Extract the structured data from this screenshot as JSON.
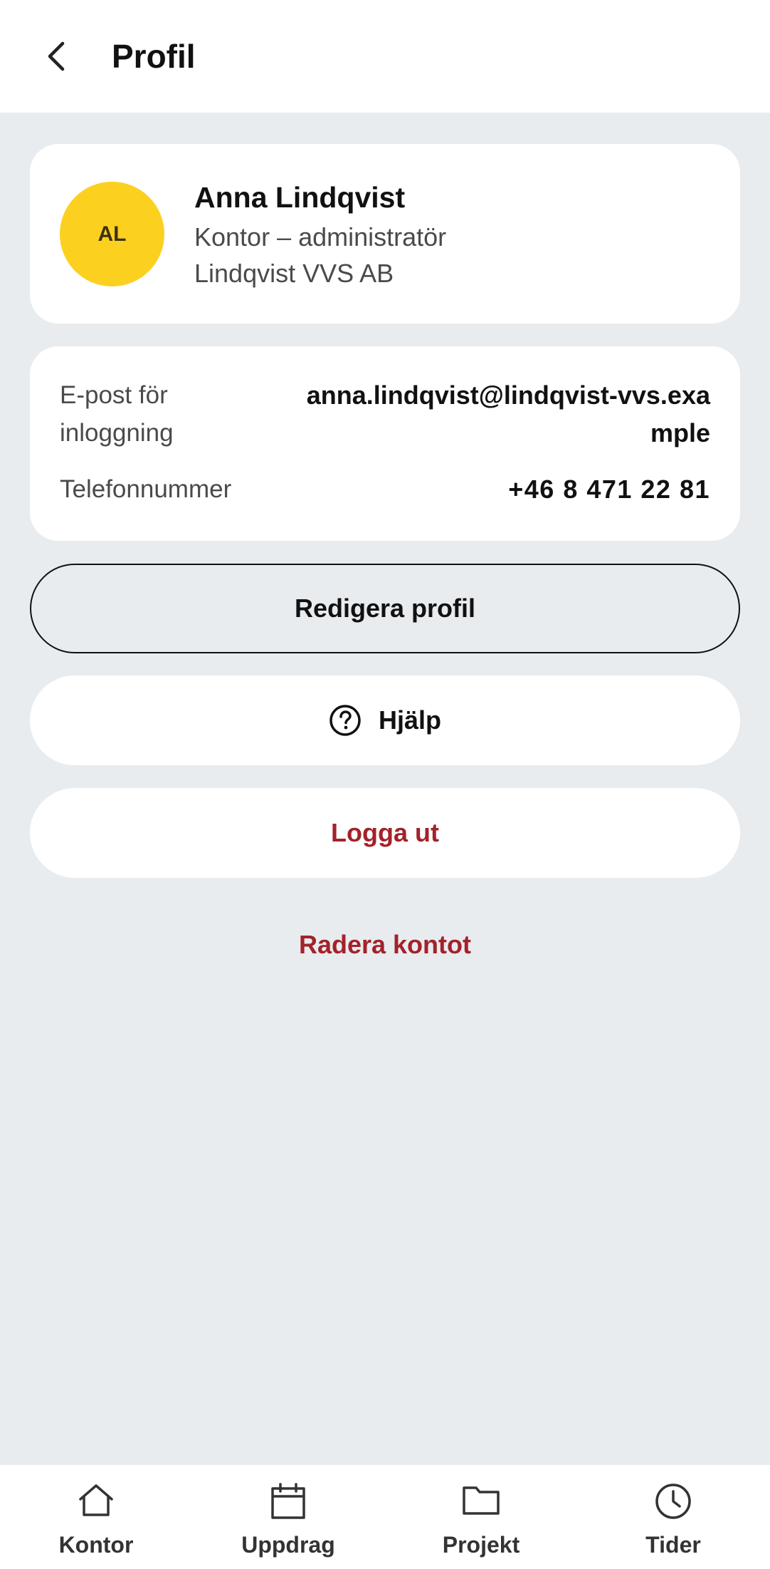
{
  "header": {
    "title": "Profil",
    "back_icon": "chevron-left-icon"
  },
  "profile": {
    "initials": "AL",
    "avatar_color": "#FCD01F",
    "name": "Anna Lindqvist",
    "role": "Kontor – administratör",
    "company": "Lindqvist VVS AB"
  },
  "info": {
    "email_label": "E-post för inloggning",
    "email_value": "anna.lindqvist@lindqvist-vvs.example",
    "phone_label": "Telefonnummer",
    "phone_value": "+46 8 471 22 81"
  },
  "actions": {
    "edit_label": "Redigera profil",
    "help_label": "Hjälp",
    "help_icon": "question-circle-icon",
    "logout_label": "Logga ut",
    "delete_label": "Radera kontot",
    "danger_color": "#A3222A"
  },
  "bottom_nav": {
    "items": [
      {
        "label": "Kontor",
        "icon": "home-icon"
      },
      {
        "label": "Uppdrag",
        "icon": "calendar-icon"
      },
      {
        "label": "Projekt",
        "icon": "folder-icon"
      },
      {
        "label": "Tider",
        "icon": "clock-icon"
      }
    ]
  }
}
